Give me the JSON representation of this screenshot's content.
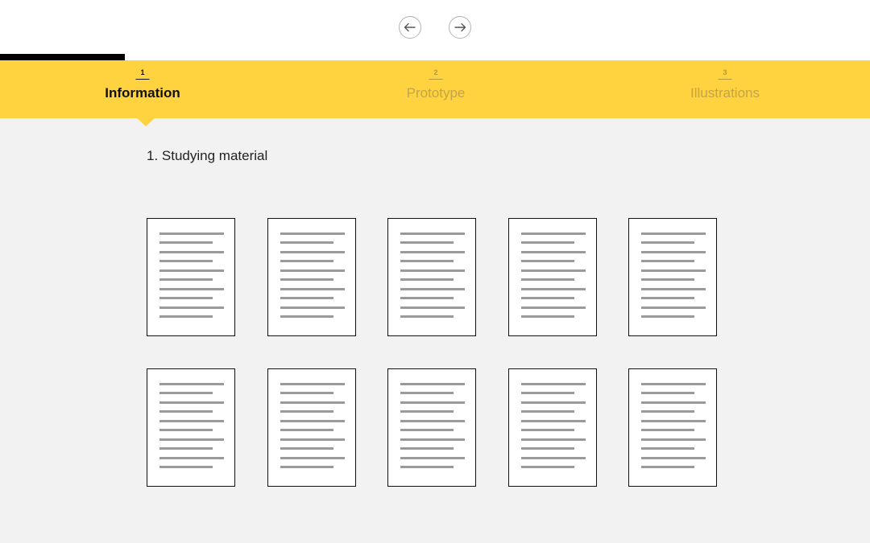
{
  "navigation": {
    "back_icon": "arrow-left-icon",
    "forward_icon": "arrow-right-icon"
  },
  "steps": [
    {
      "number": "1",
      "label": "Information",
      "active": true
    },
    {
      "number": "2",
      "label": "Prototype",
      "active": false
    },
    {
      "number": "3",
      "label": "Illustrations",
      "active": false
    }
  ],
  "section": {
    "title": "1. Studying material"
  },
  "documents": {
    "count": 10,
    "icon": "document-icon"
  },
  "colors": {
    "accent": "#ffd23f",
    "background": "#f2f2f2",
    "inactive_text": "#c2a548"
  }
}
